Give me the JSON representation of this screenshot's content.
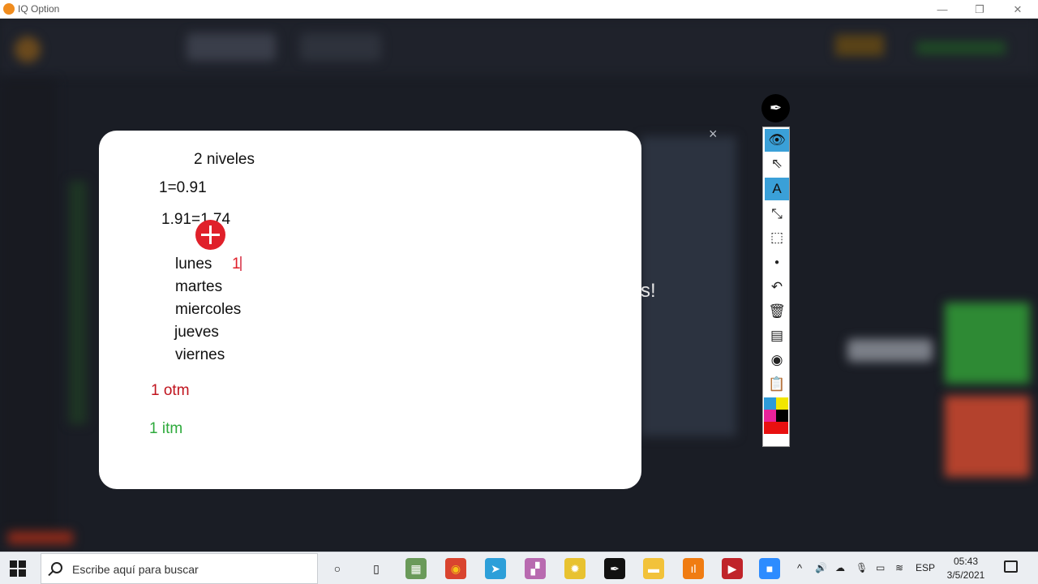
{
  "window": {
    "title": "IQ Option",
    "minimize": "—",
    "maximize": "❐",
    "close": "✕"
  },
  "background": {
    "modal_text_fragment": "s!",
    "modal_close": "×"
  },
  "whiteboard": {
    "heading": "2 niveles",
    "line1": "1=0.91",
    "line2": "1.91=1.74",
    "days": [
      "lunes",
      "martes",
      "miercoles",
      "jueves",
      "viernes"
    ],
    "monday_mark": "1",
    "otm": "1 otm",
    "itm": "1 itm",
    "colors": {
      "otm": "#c0141e",
      "itm": "#2eaa3c",
      "mark": "#e0202a"
    }
  },
  "annotation_toolbar": {
    "app_logo": "pen-nib-icon",
    "tools": [
      {
        "name": "eye-icon",
        "glyph": "👁",
        "active": true
      },
      {
        "name": "cursor-icon",
        "glyph": "⇖",
        "active": false
      },
      {
        "name": "text-tool-icon",
        "glyph": "A",
        "active": true
      },
      {
        "name": "arrow-tool-icon",
        "glyph": "⤡",
        "active": false
      },
      {
        "name": "eraser-icon",
        "glyph": "⬚",
        "active": false
      },
      {
        "name": "dot-icon",
        "glyph": "●",
        "active": false
      },
      {
        "name": "undo-icon",
        "glyph": "↶",
        "active": false
      },
      {
        "name": "trash-icon",
        "glyph": "🗑",
        "active": false
      },
      {
        "name": "board-icon",
        "glyph": "▤",
        "active": false
      },
      {
        "name": "camera-icon",
        "glyph": "◉",
        "active": false
      },
      {
        "name": "clipboard-icon",
        "glyph": "📋",
        "active": false
      }
    ],
    "palette": [
      "#2c9ad8",
      "#f2e600",
      "#e8229a",
      "#000000",
      "#e81010",
      "#e81010"
    ]
  },
  "taskbar": {
    "search_placeholder": "Escribe aquí para buscar",
    "pinned": [
      {
        "name": "cortana-icon",
        "glyph": "○",
        "color": "#ebeef2",
        "fg": "#111"
      },
      {
        "name": "task-view-icon",
        "glyph": "▯",
        "color": "#ebeef2",
        "fg": "#111"
      },
      {
        "name": "photos-app-icon",
        "glyph": "▦",
        "color": "#6a9a5a",
        "fg": "#fff"
      },
      {
        "name": "chrome-icon",
        "glyph": "◉",
        "color": "#d9442f",
        "fg": "#f5c518"
      },
      {
        "name": "telegram-icon",
        "glyph": "➤",
        "color": "#2d9fd9",
        "fg": "#fff"
      },
      {
        "name": "maps-app-icon",
        "glyph": "▞",
        "color": "#b86ab0",
        "fg": "#fff"
      },
      {
        "name": "settings-app-icon",
        "glyph": "✹",
        "color": "#e8c230",
        "fg": "#fff"
      },
      {
        "name": "pen-app-icon",
        "glyph": "✒",
        "color": "#111111",
        "fg": "#fff"
      },
      {
        "name": "file-explorer-icon",
        "glyph": "▬",
        "color": "#f2c23a",
        "fg": "#fff"
      },
      {
        "name": "iq-option-icon",
        "glyph": "ıl",
        "color": "#f07c12",
        "fg": "#fff"
      },
      {
        "name": "media-app-icon",
        "glyph": "▶",
        "color": "#c0242a",
        "fg": "#fff"
      },
      {
        "name": "zoom-icon",
        "glyph": "■",
        "color": "#2d8cff",
        "fg": "#fff"
      }
    ],
    "tray": {
      "chevron": "^",
      "volume": "🔊",
      "network": "☁",
      "mic": "🎙",
      "battery": "▭",
      "wifi": "≋",
      "language": "ESP"
    },
    "time": "05:43",
    "date": "3/5/2021"
  }
}
